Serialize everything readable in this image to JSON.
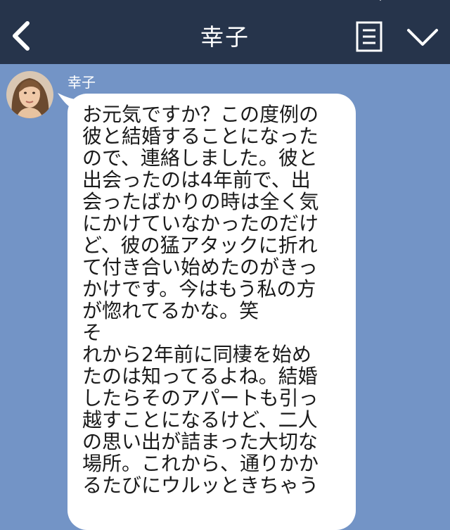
{
  "header": {
    "title": "幸子",
    "back_icon": "chevron-left-icon",
    "menu_icon": "note-menu-icon",
    "dropdown_icon": "chevron-down-icon",
    "background_color": "#26344b"
  },
  "chat": {
    "background_color": "#7394c6",
    "message": {
      "sender": "幸子",
      "avatar": "avatar-photo",
      "text": "お元気ですか？この度例の\n彼と結婚することになった\nので、連絡しました。彼と\n出会ったのは4年前で、出\n会ったばかりの時は全く気\nにかけていなかったのだけ\nど、彼の猛アタックに折れ\nて付き合い始めたのがきっ\nかけです。今はもう私の方\nが惚れてるかな。笑\nそ\nれから2年前に同棲を始め\nたのは知ってるよね。結婚\nしたらそのアパートも引っ\n越すことになるけど、二人\nの思い出が詰まった大切な\n場所。これから、通りかか\nるたびにウルッときちゃう"
    }
  }
}
